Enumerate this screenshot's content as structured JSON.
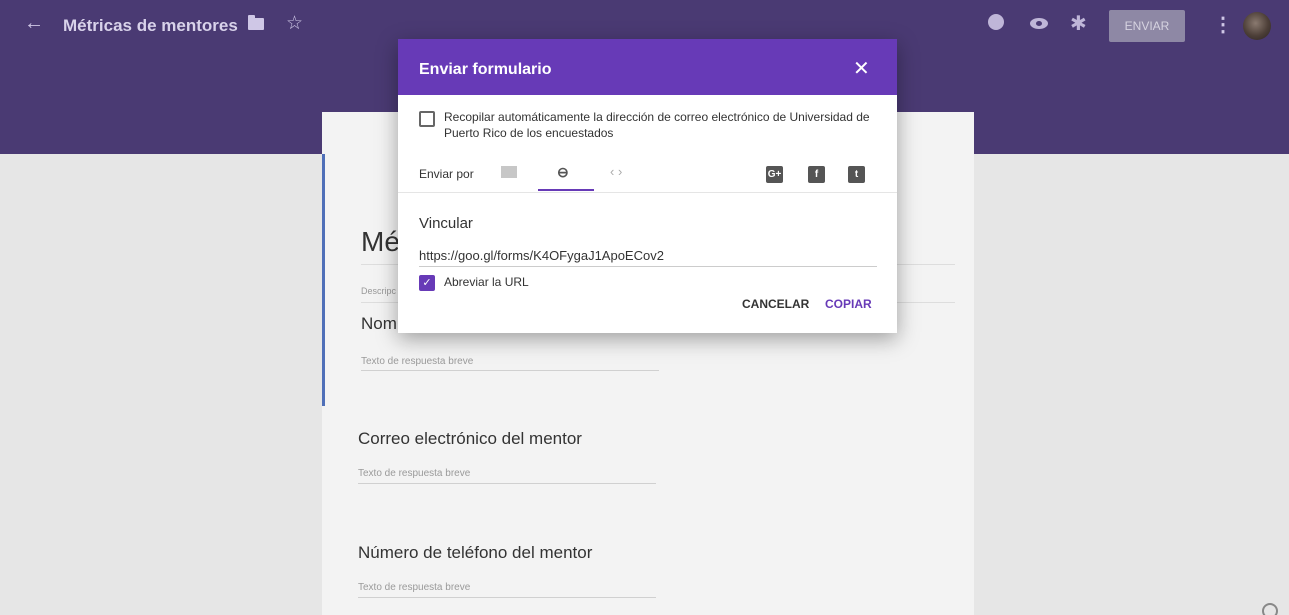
{
  "app": {
    "form_title": "Métricas de mentores",
    "send_label": "ENVIAR",
    "icons": [
      "back-arrow-icon",
      "folder-icon",
      "star-icon",
      "palette-icon",
      "eye-icon",
      "gear-icon",
      "more-vert-icon"
    ]
  },
  "form": {
    "title_partial": "Mé",
    "description_partial": "Descripc",
    "questions": [
      {
        "title": "Nomb",
        "placeholder": "Texto de respuesta breve"
      },
      {
        "title": "Correo electrónico del mentor",
        "placeholder": "Texto de respuesta breve"
      },
      {
        "title": "Número de teléfono del mentor",
        "placeholder": "Texto de respuesta breve"
      }
    ]
  },
  "dialog": {
    "title": "Enviar formulario",
    "collect_email_label": "Recopilar automáticamente la dirección de correo electrónico de Universidad de Puerto Rico de los encuestados",
    "collect_email_checked": false,
    "send_by_label": "Enviar por",
    "tabs": [
      "email",
      "link",
      "embed"
    ],
    "active_tab": "link",
    "social": {
      "gplus": "G+",
      "facebook": "f",
      "twitter": "t"
    },
    "link_panel": {
      "title": "Vincular",
      "url": "https://goo.gl/forms/K4OFygaJ1ApoECov2",
      "shorten_label": "Abreviar la URL",
      "shorten_checked": true
    },
    "cancel_label": "CANCELAR",
    "copy_label": "COPIAR"
  },
  "colors": {
    "accent": "#673ab7",
    "header_bg": "#4a3a73"
  }
}
